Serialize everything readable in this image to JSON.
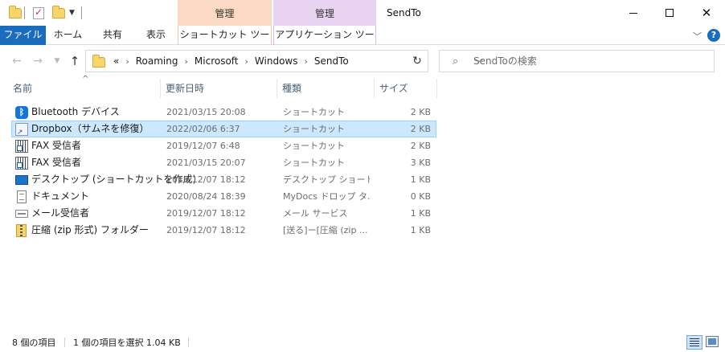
{
  "window": {
    "title": "SendTo",
    "context_tab_group_1": "管理",
    "context_tab_group_2": "管理"
  },
  "ribbon": {
    "tabs": [
      "ファイル",
      "ホーム",
      "共有",
      "表示",
      "ショートカット ツール",
      "アプリケーション ツール"
    ]
  },
  "address": {
    "overflow": "«",
    "path": [
      "Roaming",
      "Microsoft",
      "Windows",
      "SendTo"
    ]
  },
  "search": {
    "placeholder": "SendToの検索"
  },
  "columns": {
    "name": "名前",
    "date": "更新日時",
    "type": "種類",
    "size": "サイズ"
  },
  "files": [
    {
      "name": "Bluetooth デバイス",
      "date": "2021/03/15 20:08",
      "type": "ショートカット",
      "size": "2 KB",
      "icon": "bluetooth-icon",
      "selected": false
    },
    {
      "name": "Dropbox（サムネを修復）",
      "date": "2022/02/06 6:37",
      "type": "ショートカット",
      "size": "2 KB",
      "icon": "shortcut-icon",
      "selected": true
    },
    {
      "name": "FAX 受信者",
      "date": "2019/12/07 6:48",
      "type": "ショートカット",
      "size": "2 KB",
      "icon": "fax-icon",
      "selected": false
    },
    {
      "name": "FAX 受信者",
      "date": "2021/03/15 20:07",
      "type": "ショートカット",
      "size": "3 KB",
      "icon": "fax-icon",
      "selected": false
    },
    {
      "name": "デスクトップ (ショートカットを作成)",
      "date": "2019/12/07 18:12",
      "type": "デスクトップ ショートカ...",
      "size": "1 KB",
      "icon": "desktop-icon",
      "selected": false
    },
    {
      "name": "ドキュメント",
      "date": "2020/08/24 18:39",
      "type": "MyDocs ドロップ タ...",
      "size": "0 KB",
      "icon": "document-icon",
      "selected": false
    },
    {
      "name": "メール受信者",
      "date": "2019/12/07 18:12",
      "type": "メール サービス",
      "size": "1 KB",
      "icon": "mail-icon",
      "selected": false
    },
    {
      "name": "圧縮 (zip 形式) フォルダー",
      "date": "2019/12/07 18:12",
      "type": "[送る]ー[圧縮 (zip ...",
      "size": "1 KB",
      "icon": "zip-folder-icon",
      "selected": false
    }
  ],
  "status": {
    "item_count": "8 個の項目",
    "selection": "1 個の項目を選択  1.04 KB"
  },
  "colors": {
    "file_tab": "#1a6dbd",
    "context_orange": "#fbd9c4",
    "context_purple": "#e8d3f3",
    "selection": "#cce8ff"
  }
}
